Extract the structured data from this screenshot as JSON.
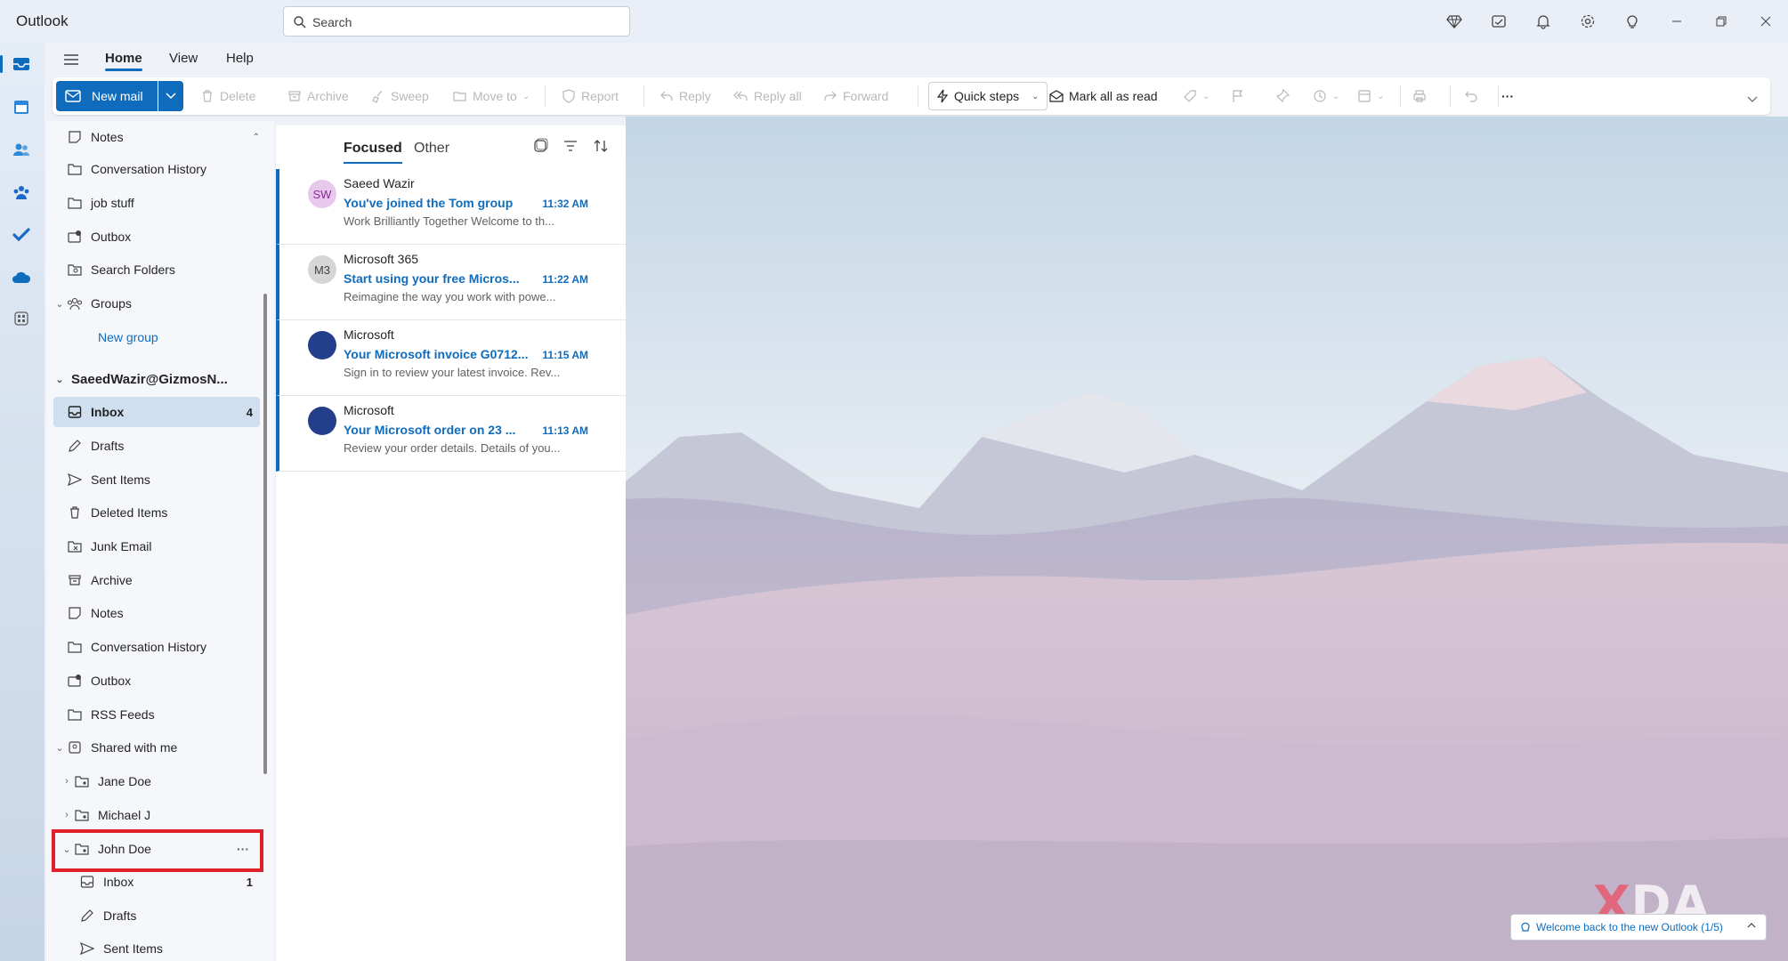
{
  "app": {
    "title": "Outlook"
  },
  "search": {
    "placeholder": "Search"
  },
  "menu": {
    "tabs": [
      "Home",
      "View",
      "Help"
    ]
  },
  "ribbon": {
    "new_mail": "New mail",
    "delete": "Delete",
    "archive": "Archive",
    "sweep": "Sweep",
    "move_to": "Move to",
    "report": "Report",
    "reply": "Reply",
    "reply_all": "Reply all",
    "forward": "Forward",
    "quick_steps": "Quick steps",
    "mark_all_read": "Mark all as read",
    "more": "···"
  },
  "folders": {
    "top": [
      "Notes",
      "Conversation History",
      "job stuff",
      "Outbox",
      "Search Folders"
    ],
    "groups_label": "Groups",
    "new_group": "New group",
    "account": "SaeedWazir@GizmosN...",
    "inbox": "Inbox",
    "inbox_count": "4",
    "account_items": [
      "Drafts",
      "Sent Items",
      "Deleted Items",
      "Junk Email",
      "Archive",
      "Notes",
      "Conversation History",
      "Outbox",
      "RSS Feeds"
    ],
    "shared_label": "Shared with me",
    "shared_people": [
      "Jane Doe",
      "Michael J",
      "John Doe"
    ],
    "john_more": "···",
    "john_inbox": "Inbox",
    "john_inbox_count": "1",
    "john_drafts": "Drafts",
    "john_sent": "Sent Items"
  },
  "message_list": {
    "tab_focused": "Focused",
    "tab_other": "Other",
    "messages": [
      {
        "initials": "SW",
        "sender": "Saeed Wazir",
        "subject": "You've joined the Tom group",
        "time": "11:32 AM",
        "preview": "Work Brilliantly Together Welcome to th..."
      },
      {
        "initials": "M3",
        "sender": "Microsoft 365",
        "subject": "Start using your free Micros...",
        "time": "11:22 AM",
        "preview": "Reimagine the way you work with powe..."
      },
      {
        "initials": "",
        "sender": "Microsoft",
        "subject": "Your Microsoft invoice G0712...",
        "time": "11:15 AM",
        "preview": "Sign in to review your latest invoice. Rev..."
      },
      {
        "initials": "",
        "sender": "Microsoft",
        "subject": "Your Microsoft order on 23 ...",
        "time": "11:13 AM",
        "preview": "Review your order details. Details of you..."
      }
    ]
  },
  "toast": {
    "text": "Welcome back to the new Outlook (1/5)"
  },
  "watermark": {
    "x": "X",
    "rest": "DA"
  },
  "colors": {
    "accent": "#0f6cbd",
    "selected": "#cfdfef",
    "highlight": "#e0202a"
  }
}
